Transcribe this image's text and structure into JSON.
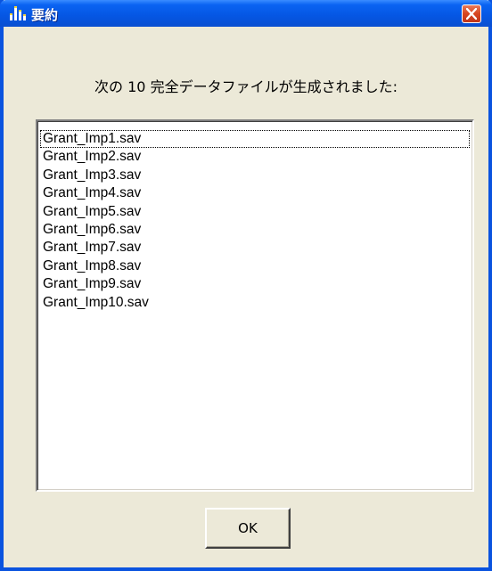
{
  "window": {
    "title": "要約",
    "icon": "chart-bar-icon",
    "close_icon": "close-icon"
  },
  "message": "次の 10 完全データファイルが生成されました:",
  "files": [
    "Grant_Imp1.sav",
    "Grant_Imp2.sav",
    "Grant_Imp3.sav",
    "Grant_Imp4.sav",
    "Grant_Imp5.sav",
    "Grant_Imp6.sav",
    "Grant_Imp7.sav",
    "Grant_Imp8.sav",
    "Grant_Imp9.sav",
    "Grant_Imp10.sav"
  ],
  "ok_button": "OK",
  "colors": {
    "titlebar": "#0556E3",
    "dialog_background": "#ECE9D8",
    "close_button": "#D6451F"
  }
}
